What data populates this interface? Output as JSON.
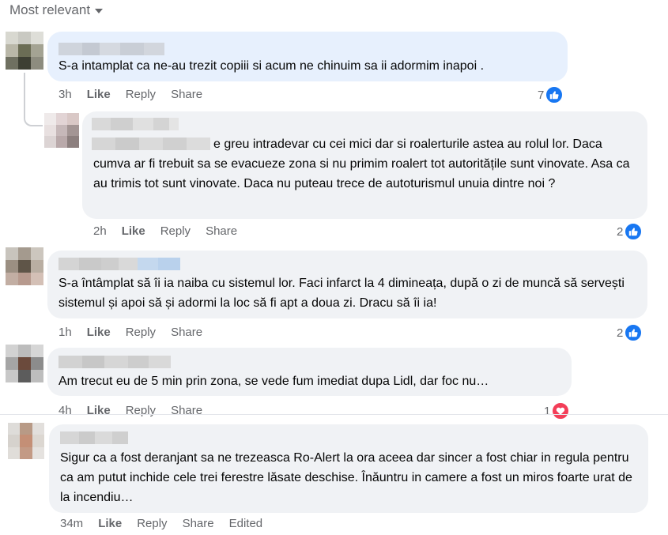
{
  "sort": {
    "label": "Most relevant"
  },
  "colors": {
    "like_blue": "#1877f2",
    "love_red": "#f33e58",
    "meta_grey": "#65676b",
    "bubble": "#f0f2f5"
  },
  "comments": [
    {
      "text": "S-a intamplat ca ne-au trezit copiii si acum ne chinuim sa ii adormim inapoi .",
      "time": "3h",
      "like": "Like",
      "reply": "Reply",
      "share": "Share",
      "reaction_count": "7",
      "reaction_icon": "like-icon"
    },
    {
      "text": "e greu intradevar cu cei mici dar si roalerturile astea au rolul lor. Daca cumva ar fi trebuit sa se evacueze zona si nu primim roalert tot autoritățile sunt vinovate. Asa ca au trimis tot sunt vinovate. Daca nu puteau trece de autoturismul unuia dintre noi ?",
      "time": "2h",
      "like": "Like",
      "reply": "Reply",
      "share": "Share",
      "reaction_count": "2",
      "reaction_icon": "like-icon"
    },
    {
      "text": "S-a întâmplat să îi ia naiba cu sistemul lor. Faci infarct la 4 dimineața, după o zi de muncă să servești sistemul și apoi să și adormi la loc să fi apt a doua zi. Dracu să îi ia!",
      "time": "1h",
      "like": "Like",
      "reply": "Reply",
      "share": "Share",
      "reaction_count": "2",
      "reaction_icon": "like-icon"
    },
    {
      "text": "Am trecut eu de 5 min prin zona, se vede fum imediat dupa Lidl, dar foc nu…",
      "time": "4h",
      "like": "Like",
      "reply": "Reply",
      "share": "Share",
      "reaction_count": "1",
      "reaction_icon": "love-icon"
    },
    {
      "text": "Sigur ca a fost deranjant sa ne trezeasca Ro-Alert la ora aceea dar sincer a fost chiar in regula pentru ca am putut inchide cele trei ferestre lăsate deschise. Înăuntru in camere a fost un miros foarte urat de la incendiu…",
      "time": "34m",
      "like": "Like",
      "reply": "Reply",
      "share": "Share",
      "edited": "Edited"
    }
  ]
}
